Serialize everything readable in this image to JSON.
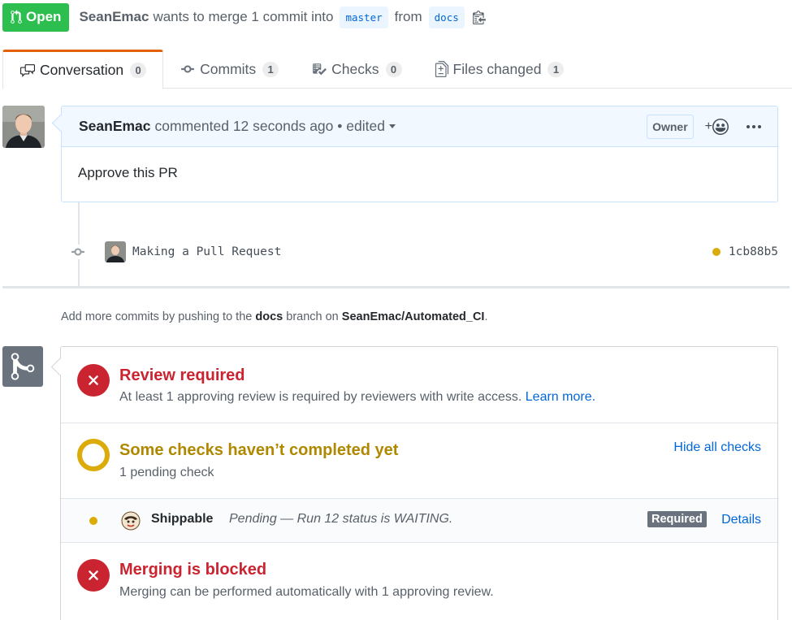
{
  "header": {
    "state": "Open",
    "author": "SeanEmac",
    "text_before": "wants to merge 1 commit into",
    "base_branch": "master",
    "text_from": "from",
    "head_branch": "docs"
  },
  "tabs": [
    {
      "label": "Conversation",
      "count": "0",
      "icon": "comment-discussion-icon",
      "selected": true
    },
    {
      "label": "Commits",
      "count": "1",
      "icon": "git-commit-icon",
      "selected": false
    },
    {
      "label": "Checks",
      "count": "0",
      "icon": "checklist-icon",
      "selected": false
    },
    {
      "label": "Files changed",
      "count": "1",
      "icon": "file-diff-icon",
      "selected": false
    }
  ],
  "comment": {
    "author": "SeanEmac",
    "meta": "commented 12 seconds ago • edited",
    "role": "Owner",
    "reaction": "+",
    "body": "Approve this PR"
  },
  "commit": {
    "message": "Making a Pull Request",
    "sha": "1cb88b5",
    "status_color": "#dbab09"
  },
  "push_note": {
    "prefix": "Add more commits by pushing to the",
    "branch": "docs",
    "middle": "branch on",
    "repo": "SeanEmac/Automated_CI",
    "suffix": "."
  },
  "merge_box": {
    "review": {
      "title": "Review required",
      "desc": "At least 1 approving review is required by reviewers with write access.",
      "link": "Learn more."
    },
    "checks": {
      "title": "Some checks haven’t completed yet",
      "desc": "1 pending check",
      "toggle": "Hide all checks"
    },
    "check_item": {
      "name": "Shippable",
      "status": "Pending — Run 12 status is WAITING.",
      "badge": "Required",
      "details": "Details"
    },
    "blocked": {
      "title": "Merging is blocked",
      "desc": "Merging can be performed automatically with 1 approving review."
    }
  },
  "colors": {
    "open_green": "#2cbe4e",
    "error_red": "#cb2431",
    "pending_yellow": "#dbab09",
    "link_blue": "#0366d6",
    "tab_accent": "#e36209"
  }
}
